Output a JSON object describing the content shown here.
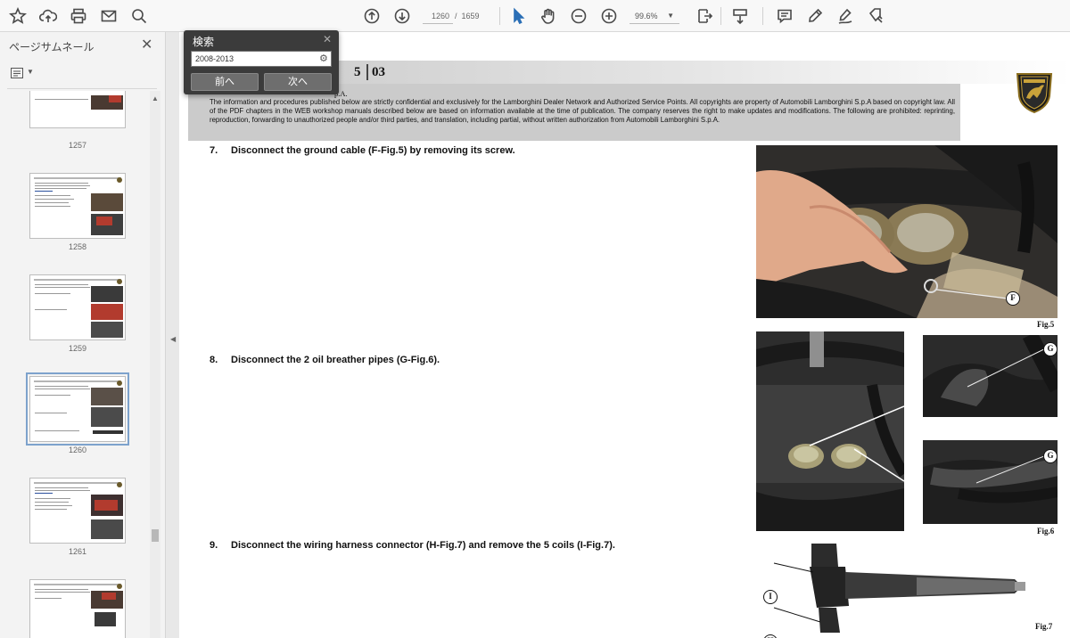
{
  "toolbar": {
    "current_page": "1260",
    "page_sep": "/",
    "total_pages": "1659",
    "zoom": "99.6%"
  },
  "sidebar": {
    "title": "ページサムネール",
    "close": "✕",
    "thumbnails": [
      {
        "label": "1257"
      },
      {
        "label": "1258"
      },
      {
        "label": "1259"
      },
      {
        "label": "1260",
        "selected": true
      },
      {
        "label": "1261"
      },
      {
        "label": ""
      }
    ]
  },
  "find": {
    "title": "検索",
    "close": "✕",
    "query": "2008-2013",
    "prev": "前へ",
    "next": "次へ"
  },
  "doc": {
    "section_left": "5",
    "section_right": "03",
    "disclaimer_head": "p.A.",
    "disclaimer": "The information and procedures published below are strictly confidential and exclusively for the Lamborghini Dealer Network and Authorized Service Points. All copyrights are property of Automobili Lamborghini S.p.A based on copyright law. All of the PDF chapters in the WEB workshop manuals described below are based on information available at the time of publication. The company reserves the right to make updates and modifications. The following are prohibited: reprinting, reproduction, forwarding to unauthorized people and/or third parties, and translation, including partial, without written authorization from Automobili Lamborghini S.p.A.",
    "steps": [
      {
        "num": "7.",
        "text": "Disconnect the ground cable (F-Fig.5) by removing its screw."
      },
      {
        "num": "8.",
        "text": "Disconnect the 2 oil breather pipes (G-Fig.6)."
      },
      {
        "num": "9.",
        "text": "Disconnect the wiring harness connector (H-Fig.7) and remove the 5 coils (I-Fig.7)."
      }
    ],
    "figures": {
      "fig5": {
        "caption": "Fig.5",
        "callout": "F"
      },
      "fig6": {
        "caption": "Fig.6",
        "callout_top": "G",
        "callout_bottom": "G"
      },
      "fig7": {
        "caption": "Fig.7",
        "callout_i": "I",
        "callout_h": "H"
      }
    }
  }
}
